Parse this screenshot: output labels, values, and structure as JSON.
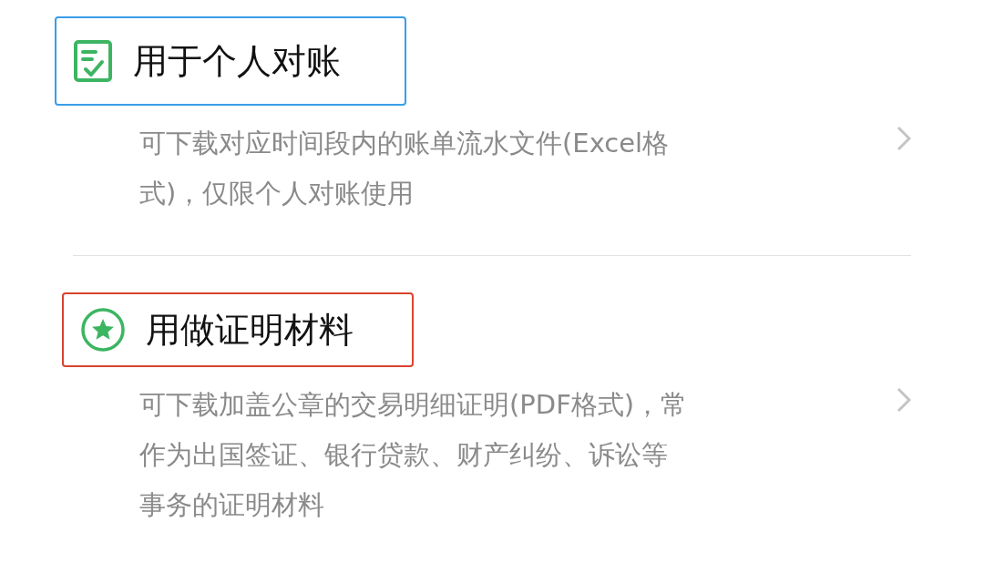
{
  "options": [
    {
      "kind": "document",
      "title": "用于个人对账",
      "color": "#3a9ee8",
      "description_lines": [
        "可下载对应时间段内的账单流水文件(Excel格",
        "式)，仅限个人对账使用"
      ]
    },
    {
      "kind": "star",
      "title": "用做证明材料",
      "color": "#d9432f",
      "description_lines": [
        "可下载加盖公章的交易明细证明(PDF格式)，常",
        "作为出国签证、银行贷款、财产纠纷、诉讼等",
        "事务的证明材料"
      ]
    }
  ]
}
